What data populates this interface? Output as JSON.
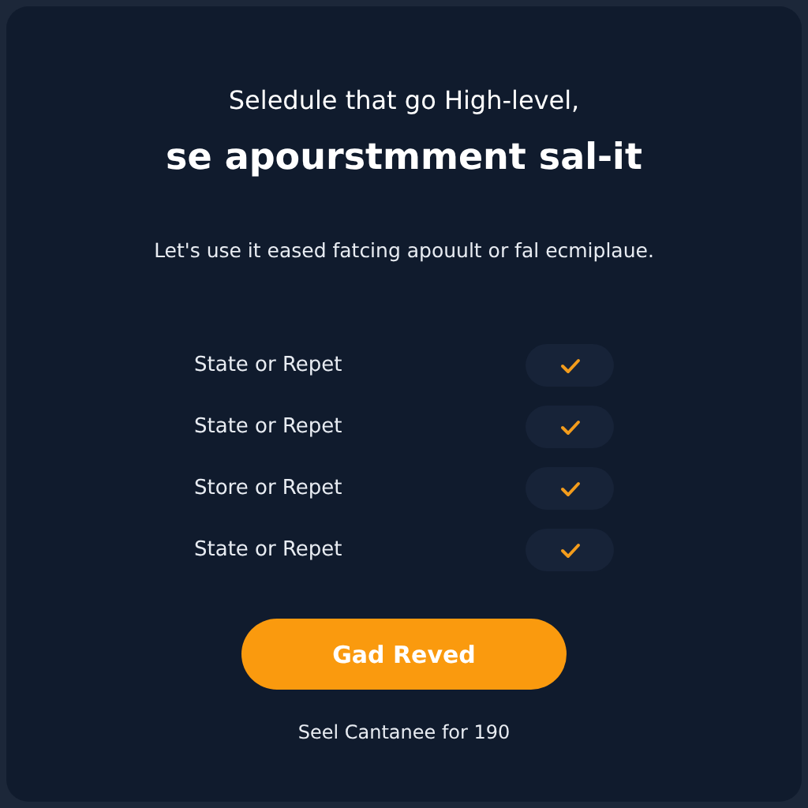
{
  "heading": "Seledule that go High-level,",
  "title": "se apourstmment sal-it",
  "subtitle": "Let's use it eased fatcing apouult or fal ecmiplaue.",
  "options": [
    {
      "label": "State or Repet",
      "checked": true
    },
    {
      "label": "State or Repet",
      "checked": true
    },
    {
      "label": "Store or Repet",
      "checked": true
    },
    {
      "label": "State or Repet",
      "checked": true
    }
  ],
  "button": "Gad Reved",
  "footer": "Seel Cantanee for 190"
}
